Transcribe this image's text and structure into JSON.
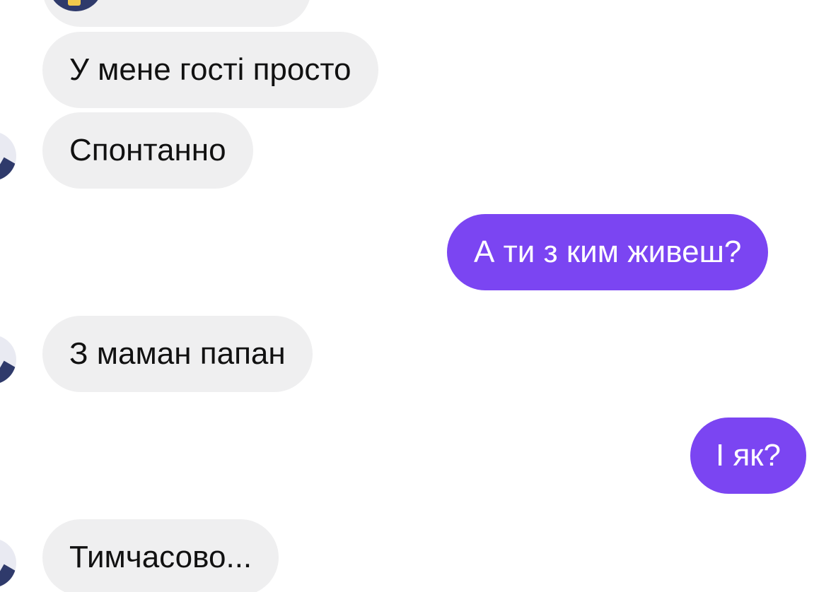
{
  "messages": [
    {
      "text": "У мене гості просто",
      "direction": "incoming"
    },
    {
      "text": "Спонтанно",
      "direction": "incoming"
    },
    {
      "text": "А ти з ким живеш?",
      "direction": "outgoing"
    },
    {
      "text": "З маман папан",
      "direction": "incoming"
    },
    {
      "text": "І як?",
      "direction": "outgoing"
    },
    {
      "text": "Тимчасово...",
      "direction": "incoming"
    }
  ],
  "colors": {
    "outgoing_bubble": "#7b45f2",
    "incoming_bubble": "#efeff0",
    "avatar_dark": "#2f3a6b",
    "avatar_light": "#e9eaf2",
    "badge": "#f2c94c"
  }
}
